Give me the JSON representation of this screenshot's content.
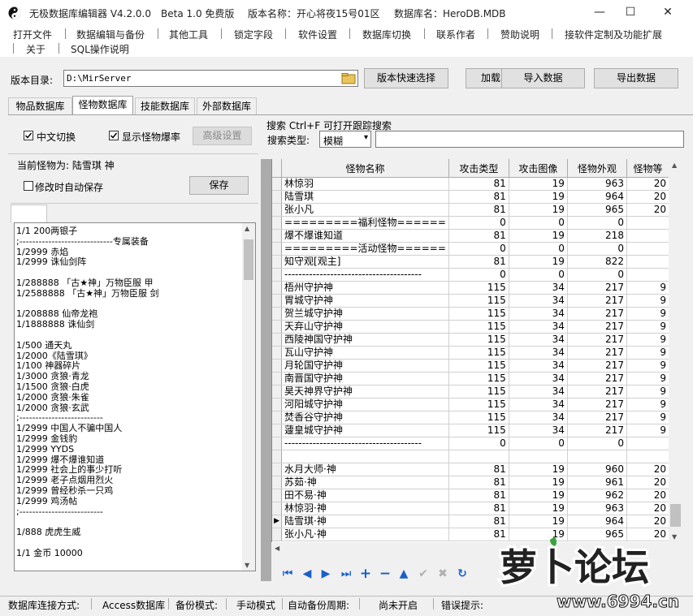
{
  "window": {
    "app_title": "无极数据库编辑器 V4.2.0.0",
    "edition": "Beta 1.0 免费版",
    "version_label": "版本名称：开心将夜15号01区",
    "db_label": "数据库名：HeroDB.MDB"
  },
  "menu": {
    "row1": [
      "打开文件",
      "数据编辑与备份",
      "其他工具",
      "锁定字段",
      "软件设置",
      "数据库切换",
      "联系作者",
      "赞助说明",
      "接软件定制及功能扩展"
    ],
    "row2": [
      "关于",
      "SQL操作说明"
    ]
  },
  "toolbar": {
    "dir_label": "版本目录:",
    "dir_value": "D:\\MirServer",
    "quick_select": "版本快速选择",
    "load": "加载",
    "import": "导入数据",
    "export": "导出数据"
  },
  "tabs": [
    "物品数据库",
    "怪物数据库",
    "技能数据库",
    "外部数据库"
  ],
  "options": {
    "chinese_switch": "中文切换",
    "show_drop_rate": "显示怪物爆率",
    "advanced": "高级设置"
  },
  "search": {
    "title": "搜索  Ctrl+F 可打开跟踪搜索",
    "type_label": "搜索类型:",
    "type_value": "模糊",
    "input_value": ""
  },
  "monster": {
    "current_label": "当前怪物为: 陆雪琪 神",
    "auto_save": "修改时自动保存",
    "save": "保存"
  },
  "drops": [
    "1/1 200两银子",
    ";-----------------------------专属装备",
    "1/2999 赤焰",
    "1/2999 诛仙剑阵",
    "",
    "1/288888 「古★神」万物臣服 甲",
    "1/2588888 「古★神」万物臣服 剑",
    "",
    "1/208888 仙帝龙袍",
    "1/1888888 诛仙剑",
    "",
    "1/500 通天丸",
    "1/2000《陆雪琪》",
    "1/100 神器碎片",
    "1/3000 贪狼·青龙",
    "1/1500 贪狼·白虎",
    "1/2000 贪狼·朱雀",
    "1/2000 贪狼·玄武",
    ";--------------------------",
    "1/2999 中国人不骗中国人",
    "1/2999 金钱豹",
    "1/2999 YYDS",
    "1/2999 爆不爆谁知道",
    "1/2999 社会上的事少打听",
    "1/2999 老子点烟用烈火",
    "1/2999 曾经秒杀一只鸡",
    "1/2999 鸡汤帖",
    ";--------------------------",
    "",
    "1/888 虎虎生威",
    "",
    "1/1 金币 10000"
  ],
  "grid": {
    "columns": [
      "怪物名称",
      "攻击类型",
      "攻击图像",
      "怪物外观",
      "怪物等"
    ],
    "rows": [
      [
        "林惊羽",
        "81",
        "19",
        "963",
        "20"
      ],
      [
        "陆雪琪",
        "81",
        "19",
        "964",
        "20"
      ],
      [
        "张小凡",
        "81",
        "19",
        "965",
        "20"
      ],
      [
        "=========福利怪物======",
        "0",
        "0",
        "0",
        ""
      ],
      [
        "爆不爆谁知道",
        "81",
        "19",
        "218",
        ""
      ],
      [
        "=========活动怪物======",
        "0",
        "0",
        "0",
        ""
      ],
      [
        "知守观[观主]",
        "81",
        "19",
        "822",
        ""
      ],
      [
        "---------------------------------------",
        "0",
        "0",
        "0",
        ""
      ],
      [
        "梧州守护神",
        "115",
        "34",
        "217",
        "9"
      ],
      [
        "胃城守护神",
        "115",
        "34",
        "217",
        "9"
      ],
      [
        "贺兰城守护神",
        "115",
        "34",
        "217",
        "9"
      ],
      [
        "天弃山守护神",
        "115",
        "34",
        "217",
        "9"
      ],
      [
        "西陵神国守护神",
        "115",
        "34",
        "217",
        "9"
      ],
      [
        "瓦山守护神",
        "115",
        "34",
        "217",
        "9"
      ],
      [
        "月轮国守护神",
        "115",
        "34",
        "217",
        "9"
      ],
      [
        "南晋国守护神",
        "115",
        "34",
        "217",
        "9"
      ],
      [
        "昊天神界守护神",
        "115",
        "34",
        "217",
        "9"
      ],
      [
        "河阳城守护神",
        "115",
        "34",
        "217",
        "9"
      ],
      [
        "焚香谷守护神",
        "115",
        "34",
        "217",
        "9"
      ],
      [
        "蘧皇城守护神",
        "115",
        "34",
        "217",
        "9"
      ],
      [
        "---------------------------------------",
        "0",
        "0",
        "0",
        ""
      ],
      [
        "",
        "",
        "",
        "",
        ""
      ],
      [
        "水月大师·神",
        "81",
        "19",
        "960",
        "20"
      ],
      [
        "苏茹·神",
        "81",
        "19",
        "961",
        "20"
      ],
      [
        "田不易·神",
        "81",
        "19",
        "962",
        "20"
      ],
      [
        "林惊羽·神",
        "81",
        "19",
        "963",
        "20"
      ],
      [
        "陆雪琪·神",
        "81",
        "19",
        "964",
        "20"
      ],
      [
        "张小凡·神",
        "81",
        "19",
        "965",
        "20"
      ]
    ],
    "current_row": 26
  },
  "status": {
    "conn_label": "数据库连接方式:",
    "conn_value": "Access数据库",
    "backup_label": "备份模式:",
    "backup_value": "手动模式",
    "auto_backup_label": "自动备份周期:",
    "auto_backup_value": "尚未开启",
    "error_label": "错误提示:"
  },
  "watermark": {
    "brand": "萝卜论坛",
    "url": "www.6994.cn"
  }
}
